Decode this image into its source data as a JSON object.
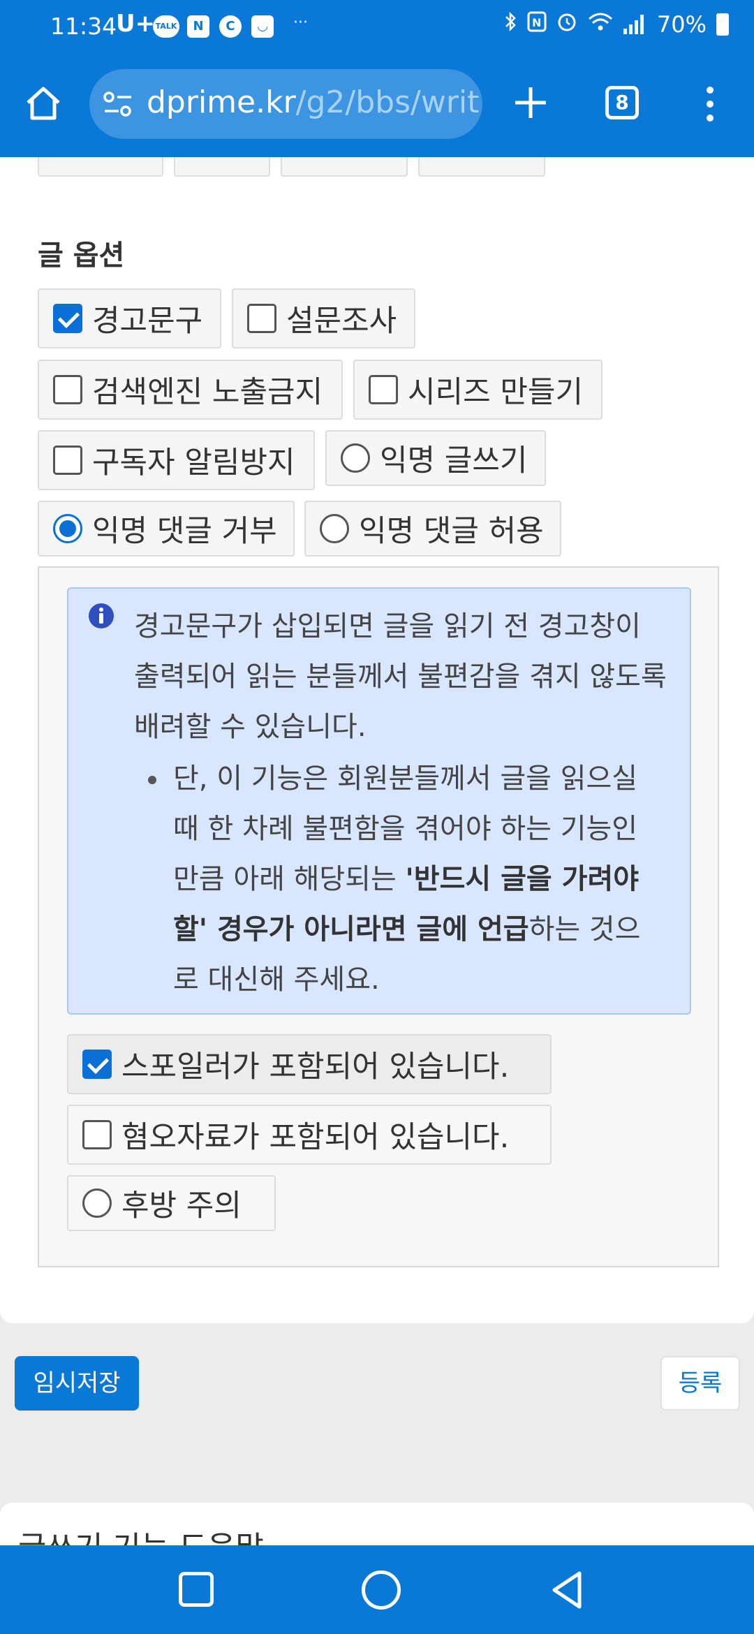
{
  "status_bar": {
    "time": "11:34",
    "carrier": "U+",
    "talk_icon": "TALK",
    "n_icon": "N",
    "c_icon": "C",
    "more": "···",
    "battery": "70%",
    "icons": [
      "bluetooth-icon",
      "nfc-icon",
      "alarm-icon",
      "wifi-icon",
      "signal-icon",
      "battery-icon"
    ]
  },
  "browser": {
    "url_host": "dprime.kr",
    "url_path": "/g2/bbs/writ",
    "tab_count": "8"
  },
  "options": {
    "title": "글 옵션",
    "warning_phrase": "경고문구",
    "survey": "설문조사",
    "no_search": "검색엔진 노출금지",
    "series": "시리즈 만들기",
    "no_notify": "구독자 알림방지",
    "anon_write": "익명 글쓰기",
    "anon_reject": "익명 댓글 거부",
    "anon_allow": "익명 댓글 허용"
  },
  "info": {
    "paragraph": "경고문구가 삽입되면 글을 읽기 전 경고창이 출력되어 읽는 분들께서 불편감을 겪지 않도록 배려할 수 있습니다.",
    "bullet_prefix": "단, 이 기능은 회원분들께서 글을 읽으실 때 한 차례 불편함을 겪어야 하는 기능인 만큼 아래 해당되는 ",
    "bullet_bold": "'반드시 글을 가려야 할' 경우가 아니라면 글에 언급",
    "bullet_suffix": "하는 것으로 대신해 주세요."
  },
  "warnings": {
    "spoiler": "스포일러가 포함되어 있습니다.",
    "disgust": "혐오자료가 포함되어 있습니다.",
    "caution": "후방 주의"
  },
  "actions": {
    "temp_save": "임시저장",
    "submit": "등록"
  },
  "help": {
    "title": "글쓰기 기능 도움말"
  },
  "colors": {
    "primary": "#0a78d7",
    "info_bg": "#d8e7ff"
  }
}
